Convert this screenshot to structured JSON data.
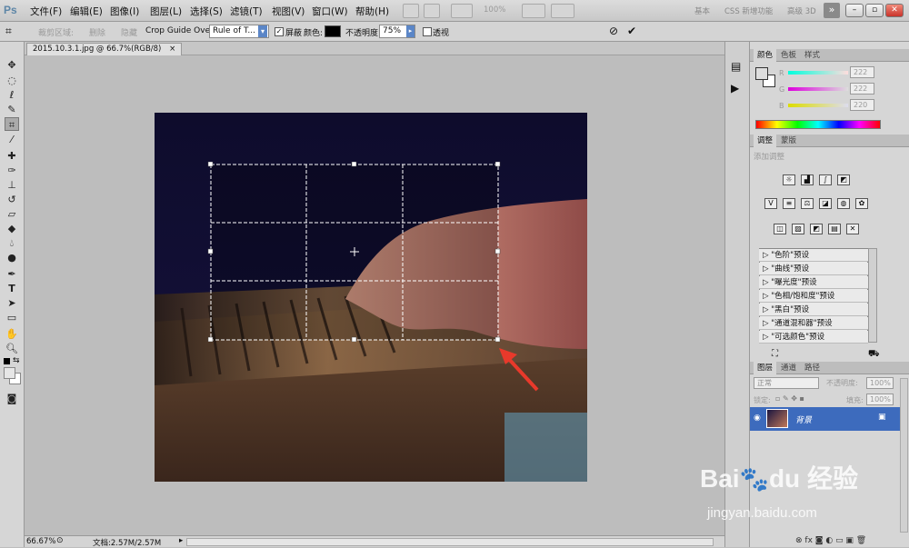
{
  "app": {
    "logo": "Ps"
  },
  "menu": [
    {
      "label": "文件(F)"
    },
    {
      "label": "编辑(E)"
    },
    {
      "label": "图像(I)"
    },
    {
      "label": "图层(L)"
    },
    {
      "label": "选择(S)"
    },
    {
      "label": "滤镜(T)"
    },
    {
      "label": "视图(V)"
    },
    {
      "label": "窗口(W)"
    },
    {
      "label": "帮助(H)"
    }
  ],
  "menubar": {
    "zoom": "100%",
    "workspaces": [
      "基本",
      "CSS 新增功能",
      "高级 3D"
    ],
    "more": "»"
  },
  "options": {
    "crop_area_delete": "删除",
    "crop_area_hide": "隐藏",
    "crop_area_label": "裁剪区域:",
    "guide_label": "Crop Guide Overlay:",
    "guide_value": "Rule of T...",
    "shield_label": "屏蔽",
    "color_label": "颜色:",
    "opacity_label": "不透明度:",
    "opacity_value": "75%",
    "perspective_label": "透视",
    "shield_color": "#000000"
  },
  "document": {
    "tab_title": "2015.10.3.1.jpg @ 66.7%(RGB/8)",
    "close": "×"
  },
  "status": {
    "zoom": "66.67%",
    "doc_info": "文档:2.57M/2.57M"
  },
  "color_panel": {
    "tabs": [
      "颜色",
      "色板",
      "样式"
    ],
    "channels": [
      {
        "name": "R",
        "value": "222"
      },
      {
        "name": "G",
        "value": "222"
      },
      {
        "name": "B",
        "value": "220"
      }
    ]
  },
  "adjust_panel": {
    "tabs": [
      "调整",
      "蒙版"
    ],
    "add_label": "添加调整",
    "presets": [
      "\"色阶\"预设",
      "\"曲线\"预设",
      "\"曝光度\"预设",
      "\"色相/饱和度\"预设",
      "\"黑白\"预设",
      "\"通道混和器\"预设",
      "\"可选颜色\"预设"
    ]
  },
  "layers_panel": {
    "tabs": [
      "图层",
      "通道",
      "路径"
    ],
    "blend_mode": "正常",
    "opacity_label": "不透明度:",
    "opacity_value": "100%",
    "lock_label": "锁定:",
    "fill_label": "填充:",
    "fill_value": "100%",
    "layer_name": "背景"
  },
  "watermark": {
    "site": "jingyan.baidu.com",
    "name": "经验"
  },
  "colors": {
    "accent": "#3d6bbd",
    "crop_border": "#ffffff",
    "arrow": "#e8392b"
  }
}
